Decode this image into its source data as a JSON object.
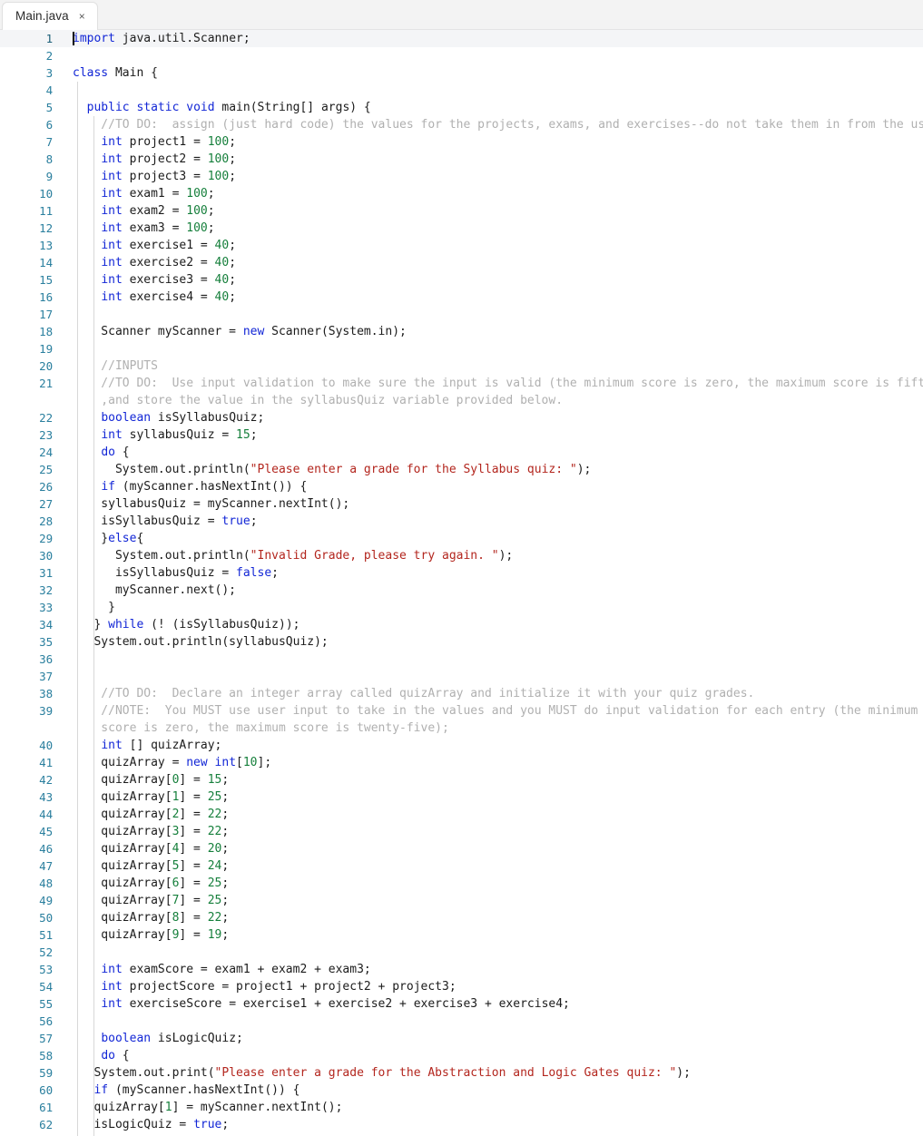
{
  "window": {
    "app_kind": "code-editor",
    "background": "#ffffff"
  },
  "tabbar": {
    "tabs": [
      {
        "label": "Main.java",
        "close_glyph": "×",
        "active": true
      }
    ]
  },
  "colors": {
    "keyword": "#1226d6",
    "number": "#157f3b",
    "string": "#b3261e",
    "comment": "#b0b0b0",
    "plain": "#1b1b1b",
    "gutter": "#2a7f9e",
    "active_line": "#f4f5f7",
    "tabbar_bg": "#f3f3f3"
  },
  "editor": {
    "language": "java",
    "caret_line": 1,
    "caret_column": 1,
    "first_visible_line": 1,
    "last_visible_line": 62,
    "lines": [
      {
        "n": 1,
        "active": true,
        "tokens": [
          {
            "t": "import",
            "c": "kw"
          },
          {
            "t": " java.util.Scanner;",
            "c": "pl"
          }
        ]
      },
      {
        "n": 2,
        "tokens": []
      },
      {
        "n": 3,
        "tokens": [
          {
            "t": "class",
            "c": "kw"
          },
          {
            "t": " Main {",
            "c": "pl"
          }
        ]
      },
      {
        "n": 4,
        "tokens": []
      },
      {
        "n": 5,
        "tokens": [
          {
            "t": "  ",
            "c": "pl"
          },
          {
            "t": "public",
            "c": "kw"
          },
          {
            "t": " ",
            "c": "pl"
          },
          {
            "t": "static",
            "c": "kw"
          },
          {
            "t": " ",
            "c": "pl"
          },
          {
            "t": "void",
            "c": "kw"
          },
          {
            "t": " main(String[] args) {",
            "c": "pl"
          }
        ]
      },
      {
        "n": 6,
        "tokens": [
          {
            "t": "    //TO DO:  assign (just hard code) the values for the projects, exams, and exercises--do not take them in from the user",
            "c": "cmt"
          }
        ]
      },
      {
        "n": 7,
        "tokens": [
          {
            "t": "    ",
            "c": "pl"
          },
          {
            "t": "int",
            "c": "kw"
          },
          {
            "t": " project1 = ",
            "c": "pl"
          },
          {
            "t": "100",
            "c": "num"
          },
          {
            "t": ";",
            "c": "pl"
          }
        ]
      },
      {
        "n": 8,
        "tokens": [
          {
            "t": "    ",
            "c": "pl"
          },
          {
            "t": "int",
            "c": "kw"
          },
          {
            "t": " project2 = ",
            "c": "pl"
          },
          {
            "t": "100",
            "c": "num"
          },
          {
            "t": ";",
            "c": "pl"
          }
        ]
      },
      {
        "n": 9,
        "tokens": [
          {
            "t": "    ",
            "c": "pl"
          },
          {
            "t": "int",
            "c": "kw"
          },
          {
            "t": " project3 = ",
            "c": "pl"
          },
          {
            "t": "100",
            "c": "num"
          },
          {
            "t": ";",
            "c": "pl"
          }
        ]
      },
      {
        "n": 10,
        "tokens": [
          {
            "t": "    ",
            "c": "pl"
          },
          {
            "t": "int",
            "c": "kw"
          },
          {
            "t": " exam1 = ",
            "c": "pl"
          },
          {
            "t": "100",
            "c": "num"
          },
          {
            "t": ";",
            "c": "pl"
          }
        ]
      },
      {
        "n": 11,
        "tokens": [
          {
            "t": "    ",
            "c": "pl"
          },
          {
            "t": "int",
            "c": "kw"
          },
          {
            "t": " exam2 = ",
            "c": "pl"
          },
          {
            "t": "100",
            "c": "num"
          },
          {
            "t": ";",
            "c": "pl"
          }
        ]
      },
      {
        "n": 12,
        "tokens": [
          {
            "t": "    ",
            "c": "pl"
          },
          {
            "t": "int",
            "c": "kw"
          },
          {
            "t": " exam3 = ",
            "c": "pl"
          },
          {
            "t": "100",
            "c": "num"
          },
          {
            "t": ";",
            "c": "pl"
          }
        ]
      },
      {
        "n": 13,
        "tokens": [
          {
            "t": "    ",
            "c": "pl"
          },
          {
            "t": "int",
            "c": "kw"
          },
          {
            "t": " exercise1 = ",
            "c": "pl"
          },
          {
            "t": "40",
            "c": "num"
          },
          {
            "t": ";",
            "c": "pl"
          }
        ]
      },
      {
        "n": 14,
        "tokens": [
          {
            "t": "    ",
            "c": "pl"
          },
          {
            "t": "int",
            "c": "kw"
          },
          {
            "t": " exercise2 = ",
            "c": "pl"
          },
          {
            "t": "40",
            "c": "num"
          },
          {
            "t": ";",
            "c": "pl"
          }
        ]
      },
      {
        "n": 15,
        "tokens": [
          {
            "t": "    ",
            "c": "pl"
          },
          {
            "t": "int",
            "c": "kw"
          },
          {
            "t": " exercise3 = ",
            "c": "pl"
          },
          {
            "t": "40",
            "c": "num"
          },
          {
            "t": ";",
            "c": "pl"
          }
        ]
      },
      {
        "n": 16,
        "tokens": [
          {
            "t": "    ",
            "c": "pl"
          },
          {
            "t": "int",
            "c": "kw"
          },
          {
            "t": " exercise4 = ",
            "c": "pl"
          },
          {
            "t": "40",
            "c": "num"
          },
          {
            "t": ";",
            "c": "pl"
          }
        ]
      },
      {
        "n": 17,
        "tokens": []
      },
      {
        "n": 18,
        "tokens": [
          {
            "t": "    Scanner myScanner = ",
            "c": "pl"
          },
          {
            "t": "new",
            "c": "kw"
          },
          {
            "t": " Scanner(System.in);",
            "c": "pl"
          }
        ]
      },
      {
        "n": 19,
        "tokens": []
      },
      {
        "n": 20,
        "tokens": [
          {
            "t": "    //INPUTS",
            "c": "cmt"
          }
        ]
      },
      {
        "n": 21,
        "tokens": [
          {
            "t": "    //TO DO:  Use input validation to make sure the input is valid (the minimum score is zero, the maximum score is fifteen)",
            "c": "cmt"
          }
        ]
      },
      {
        "n": null,
        "wrapped": true,
        "tokens": [
          {
            "t": "    ,and store the value in the syllabusQuiz variable provided below.",
            "c": "cmt"
          }
        ]
      },
      {
        "n": 22,
        "tokens": [
          {
            "t": "    ",
            "c": "pl"
          },
          {
            "t": "boolean",
            "c": "kw"
          },
          {
            "t": " isSyllabusQuiz;",
            "c": "pl"
          }
        ]
      },
      {
        "n": 23,
        "tokens": [
          {
            "t": "    ",
            "c": "pl"
          },
          {
            "t": "int",
            "c": "kw"
          },
          {
            "t": " syllabusQuiz = ",
            "c": "pl"
          },
          {
            "t": "15",
            "c": "num"
          },
          {
            "t": ";",
            "c": "pl"
          }
        ]
      },
      {
        "n": 24,
        "tokens": [
          {
            "t": "    ",
            "c": "pl"
          },
          {
            "t": "do",
            "c": "kw"
          },
          {
            "t": " {",
            "c": "pl"
          }
        ]
      },
      {
        "n": 25,
        "tokens": [
          {
            "t": "      System.out.println(",
            "c": "pl"
          },
          {
            "t": "\"Please enter a grade for the Syllabus quiz: \"",
            "c": "str"
          },
          {
            "t": ");",
            "c": "pl"
          }
        ]
      },
      {
        "n": 26,
        "tokens": [
          {
            "t": "    ",
            "c": "pl"
          },
          {
            "t": "if",
            "c": "kw"
          },
          {
            "t": " (myScanner.hasNextInt()) {",
            "c": "pl"
          }
        ]
      },
      {
        "n": 27,
        "tokens": [
          {
            "t": "    syllabusQuiz = myScanner.nextInt();",
            "c": "pl"
          }
        ]
      },
      {
        "n": 28,
        "tokens": [
          {
            "t": "    isSyllabusQuiz = ",
            "c": "pl"
          },
          {
            "t": "true",
            "c": "kw"
          },
          {
            "t": ";",
            "c": "pl"
          }
        ]
      },
      {
        "n": 29,
        "tokens": [
          {
            "t": "    }",
            "c": "pl"
          },
          {
            "t": "else",
            "c": "kw"
          },
          {
            "t": "{",
            "c": "pl"
          }
        ]
      },
      {
        "n": 30,
        "tokens": [
          {
            "t": "      System.out.println(",
            "c": "pl"
          },
          {
            "t": "\"Invalid Grade, please try again. \"",
            "c": "str"
          },
          {
            "t": ");",
            "c": "pl"
          }
        ]
      },
      {
        "n": 31,
        "tokens": [
          {
            "t": "      isSyllabusQuiz = ",
            "c": "pl"
          },
          {
            "t": "false",
            "c": "kw"
          },
          {
            "t": ";",
            "c": "pl"
          }
        ]
      },
      {
        "n": 32,
        "tokens": [
          {
            "t": "      myScanner.next();",
            "c": "pl"
          }
        ]
      },
      {
        "n": 33,
        "tokens": [
          {
            "t": "     }",
            "c": "pl"
          }
        ]
      },
      {
        "n": 34,
        "tokens": [
          {
            "t": "   } ",
            "c": "pl"
          },
          {
            "t": "while",
            "c": "kw"
          },
          {
            "t": " (! (isSyllabusQuiz));",
            "c": "pl"
          }
        ]
      },
      {
        "n": 35,
        "tokens": [
          {
            "t": "   System.out.println(syllabusQuiz);",
            "c": "pl"
          }
        ]
      },
      {
        "n": 36,
        "tokens": []
      },
      {
        "n": 37,
        "tokens": []
      },
      {
        "n": 38,
        "tokens": [
          {
            "t": "    //TO DO:  Declare an integer array called quizArray and initialize it with your quiz grades.",
            "c": "cmt"
          }
        ]
      },
      {
        "n": 39,
        "tokens": [
          {
            "t": "    //NOTE:  You MUST use user input to take in the values and you MUST do input validation for each entry (the minimum",
            "c": "cmt"
          }
        ]
      },
      {
        "n": null,
        "wrapped": true,
        "tokens": [
          {
            "t": "    score is zero, the maximum score is twenty-five);",
            "c": "cmt"
          }
        ]
      },
      {
        "n": 40,
        "tokens": [
          {
            "t": "    ",
            "c": "pl"
          },
          {
            "t": "int",
            "c": "kw"
          },
          {
            "t": " [] quizArray;",
            "c": "pl"
          }
        ]
      },
      {
        "n": 41,
        "tokens": [
          {
            "t": "    quizArray = ",
            "c": "pl"
          },
          {
            "t": "new",
            "c": "kw"
          },
          {
            "t": " ",
            "c": "pl"
          },
          {
            "t": "int",
            "c": "kw"
          },
          {
            "t": "[",
            "c": "pl"
          },
          {
            "t": "10",
            "c": "num"
          },
          {
            "t": "];",
            "c": "pl"
          }
        ]
      },
      {
        "n": 42,
        "tokens": [
          {
            "t": "    quizArray[",
            "c": "pl"
          },
          {
            "t": "0",
            "c": "num"
          },
          {
            "t": "] = ",
            "c": "pl"
          },
          {
            "t": "15",
            "c": "num"
          },
          {
            "t": ";",
            "c": "pl"
          }
        ]
      },
      {
        "n": 43,
        "tokens": [
          {
            "t": "    quizArray[",
            "c": "pl"
          },
          {
            "t": "1",
            "c": "num"
          },
          {
            "t": "] = ",
            "c": "pl"
          },
          {
            "t": "25",
            "c": "num"
          },
          {
            "t": ";",
            "c": "pl"
          }
        ]
      },
      {
        "n": 44,
        "tokens": [
          {
            "t": "    quizArray[",
            "c": "pl"
          },
          {
            "t": "2",
            "c": "num"
          },
          {
            "t": "] = ",
            "c": "pl"
          },
          {
            "t": "22",
            "c": "num"
          },
          {
            "t": ";",
            "c": "pl"
          }
        ]
      },
      {
        "n": 45,
        "tokens": [
          {
            "t": "    quizArray[",
            "c": "pl"
          },
          {
            "t": "3",
            "c": "num"
          },
          {
            "t": "] = ",
            "c": "pl"
          },
          {
            "t": "22",
            "c": "num"
          },
          {
            "t": ";",
            "c": "pl"
          }
        ]
      },
      {
        "n": 46,
        "tokens": [
          {
            "t": "    quizArray[",
            "c": "pl"
          },
          {
            "t": "4",
            "c": "num"
          },
          {
            "t": "] = ",
            "c": "pl"
          },
          {
            "t": "20",
            "c": "num"
          },
          {
            "t": ";",
            "c": "pl"
          }
        ]
      },
      {
        "n": 47,
        "tokens": [
          {
            "t": "    quizArray[",
            "c": "pl"
          },
          {
            "t": "5",
            "c": "num"
          },
          {
            "t": "] = ",
            "c": "pl"
          },
          {
            "t": "24",
            "c": "num"
          },
          {
            "t": ";",
            "c": "pl"
          }
        ]
      },
      {
        "n": 48,
        "tokens": [
          {
            "t": "    quizArray[",
            "c": "pl"
          },
          {
            "t": "6",
            "c": "num"
          },
          {
            "t": "] = ",
            "c": "pl"
          },
          {
            "t": "25",
            "c": "num"
          },
          {
            "t": ";",
            "c": "pl"
          }
        ]
      },
      {
        "n": 49,
        "tokens": [
          {
            "t": "    quizArray[",
            "c": "pl"
          },
          {
            "t": "7",
            "c": "num"
          },
          {
            "t": "] = ",
            "c": "pl"
          },
          {
            "t": "25",
            "c": "num"
          },
          {
            "t": ";",
            "c": "pl"
          }
        ]
      },
      {
        "n": 50,
        "tokens": [
          {
            "t": "    quizArray[",
            "c": "pl"
          },
          {
            "t": "8",
            "c": "num"
          },
          {
            "t": "] = ",
            "c": "pl"
          },
          {
            "t": "22",
            "c": "num"
          },
          {
            "t": ";",
            "c": "pl"
          }
        ]
      },
      {
        "n": 51,
        "tokens": [
          {
            "t": "    quizArray[",
            "c": "pl"
          },
          {
            "t": "9",
            "c": "num"
          },
          {
            "t": "] = ",
            "c": "pl"
          },
          {
            "t": "19",
            "c": "num"
          },
          {
            "t": ";",
            "c": "pl"
          }
        ]
      },
      {
        "n": 52,
        "tokens": []
      },
      {
        "n": 53,
        "tokens": [
          {
            "t": "    ",
            "c": "pl"
          },
          {
            "t": "int",
            "c": "kw"
          },
          {
            "t": " examScore = exam1 + exam2 + exam3;",
            "c": "pl"
          }
        ]
      },
      {
        "n": 54,
        "tokens": [
          {
            "t": "    ",
            "c": "pl"
          },
          {
            "t": "int",
            "c": "kw"
          },
          {
            "t": " projectScore = project1 + project2 + project3;",
            "c": "pl"
          }
        ]
      },
      {
        "n": 55,
        "tokens": [
          {
            "t": "    ",
            "c": "pl"
          },
          {
            "t": "int",
            "c": "kw"
          },
          {
            "t": " exerciseScore = exercise1 + exercise2 + exercise3 + exercise4;",
            "c": "pl"
          }
        ]
      },
      {
        "n": 56,
        "tokens": []
      },
      {
        "n": 57,
        "tokens": [
          {
            "t": "    ",
            "c": "pl"
          },
          {
            "t": "boolean",
            "c": "kw"
          },
          {
            "t": " isLogicQuiz;",
            "c": "pl"
          }
        ]
      },
      {
        "n": 58,
        "tokens": [
          {
            "t": "    ",
            "c": "pl"
          },
          {
            "t": "do",
            "c": "kw"
          },
          {
            "t": " {",
            "c": "pl"
          }
        ]
      },
      {
        "n": 59,
        "tokens": [
          {
            "t": "   System.out.print(",
            "c": "pl"
          },
          {
            "t": "\"Please enter a grade for the Abstraction and Logic Gates quiz: \"",
            "c": "str"
          },
          {
            "t": ");",
            "c": "pl"
          }
        ]
      },
      {
        "n": 60,
        "tokens": [
          {
            "t": "   ",
            "c": "pl"
          },
          {
            "t": "if",
            "c": "kw"
          },
          {
            "t": " (myScanner.hasNextInt()) {",
            "c": "pl"
          }
        ]
      },
      {
        "n": 61,
        "tokens": [
          {
            "t": "   quizArray[",
            "c": "pl"
          },
          {
            "t": "1",
            "c": "num"
          },
          {
            "t": "] = myScanner.nextInt();",
            "c": "pl"
          }
        ]
      },
      {
        "n": 62,
        "tokens": [
          {
            "t": "   isLogicQuiz = ",
            "c": "pl"
          },
          {
            "t": "true",
            "c": "kw"
          },
          {
            "t": ";",
            "c": "pl"
          }
        ]
      }
    ]
  }
}
